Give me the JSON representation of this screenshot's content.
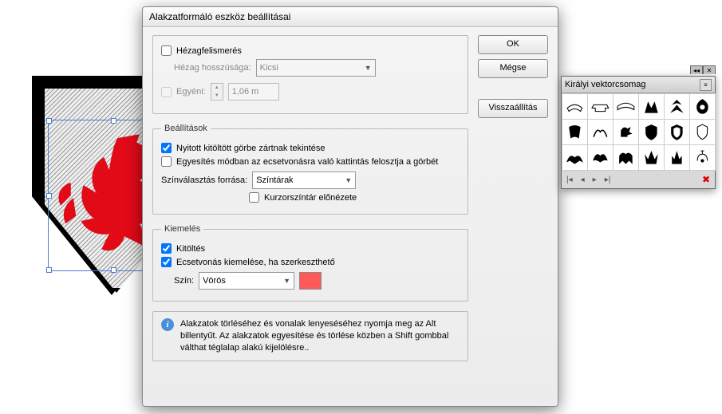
{
  "dialog": {
    "title": "Alakzatformáló eszköz beállításai",
    "gap": {
      "detect_label": "Hézagfelismerés",
      "length_label": "Hézag hosszúsága:",
      "length_value": "Kicsi",
      "custom_label": "Egyéni:",
      "custom_value": "1,06 m"
    },
    "settings": {
      "legend": "Beállítások",
      "opt1_label": "Nyitott kitöltött görbe zártnak tekintése",
      "opt2_label": "Egyesítés módban az ecsetvonásra való kattintás felosztja a görbét",
      "source_label": "Színválasztás forrása:",
      "source_value": "Színtárak",
      "cursor_label": "Kurzorszíntár előnézete"
    },
    "highlight": {
      "legend": "Kiemelés",
      "fill_label": "Kitöltés",
      "stroke_label": "Ecsetvonás kiemelése, ha szerkeszthető",
      "color_label": "Szín:",
      "color_value": "Vörös",
      "swatch_hex": "#ff5a5a"
    },
    "info_text": "Alakzatok törléséhez és vonalak lenyeséséhez nyomja meg az Alt billentyűt. Az alakzatok egyesítése és törlése közben a Shift gombbal válthat téglalap alakú kijelölésre..",
    "buttons": {
      "ok": "OK",
      "cancel": "Mégse",
      "reset": "Visszaállítás"
    }
  },
  "panel": {
    "title": "Királyi vektorcsomag"
  }
}
